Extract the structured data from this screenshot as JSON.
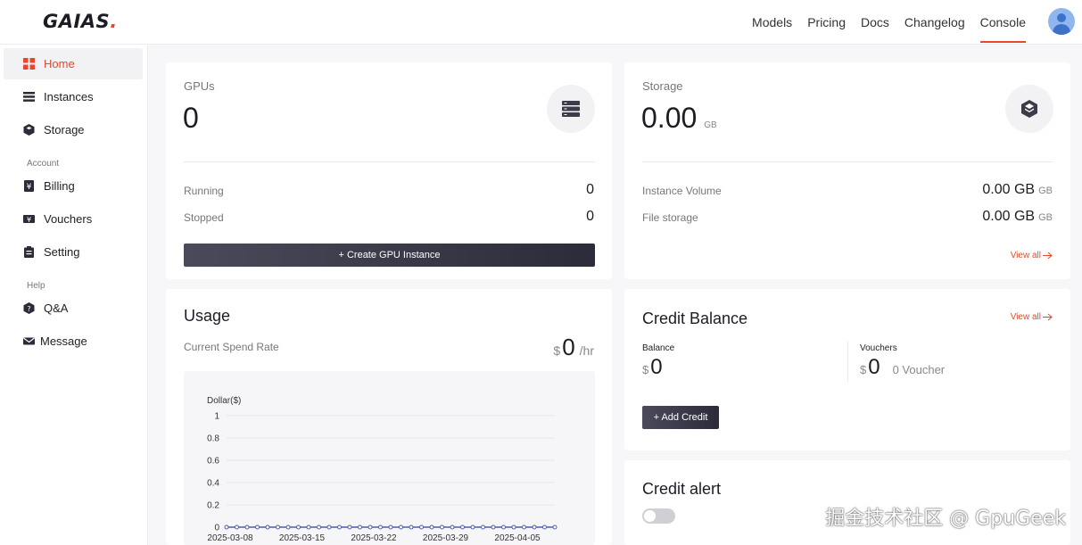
{
  "brand": {
    "name": "GAIAS",
    "dot": ".",
    "accent": "#e8472a"
  },
  "nav": {
    "items": [
      {
        "label": "Models"
      },
      {
        "label": "Pricing"
      },
      {
        "label": "Docs"
      },
      {
        "label": "Changelog"
      },
      {
        "label": "Console",
        "active": true
      }
    ]
  },
  "sidebar": {
    "items": [
      {
        "label": "Home",
        "icon": "grid-icon",
        "active": true
      },
      {
        "label": "Instances",
        "icon": "list-icon"
      },
      {
        "label": "Storage",
        "icon": "cube-icon"
      }
    ],
    "account_header": "Account",
    "account_items": [
      {
        "label": "Billing",
        "icon": "billing-icon"
      },
      {
        "label": "Vouchers",
        "icon": "voucher-icon"
      },
      {
        "label": "Setting",
        "icon": "clipboard-icon"
      }
    ],
    "help_header": "Help",
    "help_items": [
      {
        "label": "Q&A",
        "icon": "question-icon"
      },
      {
        "label": "Message",
        "icon": "mail-icon"
      }
    ]
  },
  "gpus": {
    "title": "GPUs",
    "count": "0",
    "running_label": "Running",
    "running_value": "0",
    "stopped_label": "Stopped",
    "stopped_value": "0",
    "create_button": "+ Create GPU Instance"
  },
  "storage": {
    "title": "Storage",
    "total": "0.00",
    "unit": "GB",
    "instance_volume_label": "Instance Volume",
    "instance_volume_value": "0.00 GB",
    "file_storage_label": "File storage",
    "file_storage_value": "0.00 GB",
    "unit_small": "GB",
    "view_all": "View all"
  },
  "usage": {
    "title": "Usage",
    "spend_label": "Current Spend Rate",
    "currency": "$",
    "rate": "0",
    "per": "/hr"
  },
  "credit": {
    "title": "Credit Balance",
    "view_all": "View all",
    "balance_label": "Balance",
    "balance_currency": "$",
    "balance_value": "0",
    "vouchers_label": "Vouchers",
    "vouchers_currency": "$",
    "vouchers_value": "0",
    "voucher_count": "0 Voucher",
    "add_button": "+ Add Credit"
  },
  "alert": {
    "title": "Credit alert",
    "enabled": false
  },
  "watermark": "掘金技术社区 @ GpuGeek",
  "chart_data": {
    "type": "line",
    "ylabel": "Dollar($)",
    "ylim": [
      0,
      1
    ],
    "yticks": [
      "0",
      "0.2",
      "0.4",
      "0.6",
      "0.8",
      "1"
    ],
    "xticks": [
      "2025-03-08",
      "2025-03-15",
      "2025-03-22",
      "2025-03-29",
      "2025-04-05"
    ],
    "series": [
      {
        "color": "#4b5fa8",
        "values": [
          0,
          0,
          0,
          0,
          0,
          0,
          0,
          0,
          0,
          0,
          0,
          0,
          0,
          0,
          0,
          0,
          0,
          0,
          0,
          0,
          0,
          0,
          0,
          0,
          0,
          0,
          0,
          0,
          0,
          0,
          0,
          0,
          0
        ]
      }
    ]
  }
}
